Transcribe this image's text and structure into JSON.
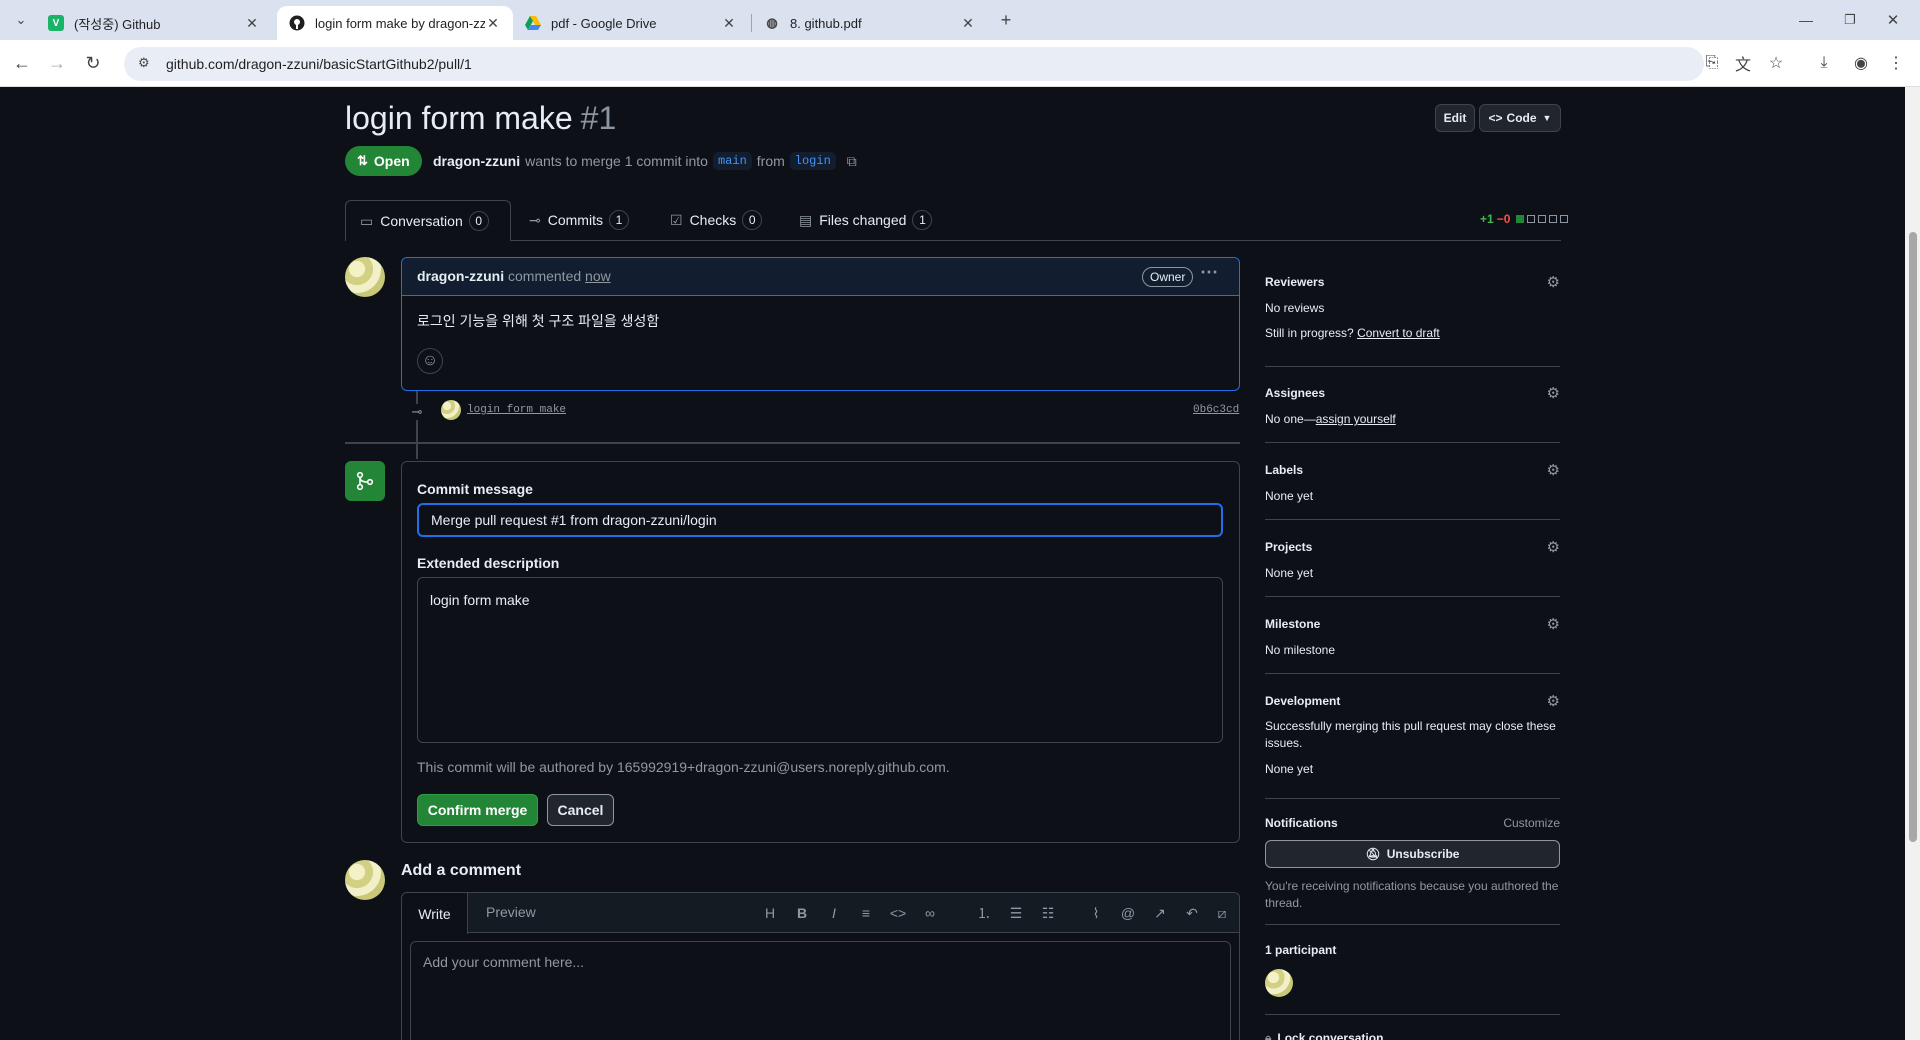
{
  "browser": {
    "tabs": [
      {
        "title": "(작성중) Github",
        "favicon": "V"
      },
      {
        "title": "login form make by dragon-zz",
        "favicon": "github-icon"
      },
      {
        "title": "pdf - Google Drive",
        "favicon": "drive-icon"
      },
      {
        "title": "8. github.pdf",
        "favicon": "globe-icon"
      }
    ],
    "url": "github.com/dragon-zzuni/basicStartGithub2/pull/1"
  },
  "pr": {
    "title": "login form make",
    "number": "#1",
    "status": "Open",
    "author": "dragon-zzuni",
    "merge_text": "wants to merge 1 commit into",
    "base_branch": "main",
    "from_text": "from",
    "head_branch": "login",
    "edit_label": "Edit",
    "code_label": "Code"
  },
  "tabs": [
    {
      "label": "Conversation",
      "count": "0"
    },
    {
      "label": "Commits",
      "count": "1"
    },
    {
      "label": "Checks",
      "count": "0"
    },
    {
      "label": "Files changed",
      "count": "1"
    }
  ],
  "diffstat": {
    "add": "+1",
    "del": "−0"
  },
  "comment": {
    "author": "dragon-zzuni",
    "action": "commented",
    "time": "now",
    "badge": "Owner",
    "body": "로그인 기능을 위해 첫 구조 파일을 생성함"
  },
  "commit": {
    "message": "login form make",
    "sha": "0b6c3cd"
  },
  "merge": {
    "commit_message_label": "Commit message",
    "commit_message_value": "Merge pull request #1 from dragon-zzuni/login",
    "extended_label": "Extended description",
    "extended_value": "login form make",
    "authored_note": "This commit will be authored by 165992919+dragon-zzuni@users.noreply.github.com.",
    "confirm_label": "Confirm merge",
    "cancel_label": "Cancel"
  },
  "add_comment": {
    "heading": "Add a comment",
    "write_tab": "Write",
    "preview_tab": "Preview",
    "placeholder": "Add your comment here..."
  },
  "sidebar": {
    "reviewers": {
      "label": "Reviewers",
      "value": "No reviews",
      "progress_text": "Still in progress?",
      "draft_link": "Convert to draft"
    },
    "assignees": {
      "label": "Assignees",
      "value": "No one—",
      "link": "assign yourself"
    },
    "labels": {
      "label": "Labels",
      "value": "None yet"
    },
    "projects": {
      "label": "Projects",
      "value": "None yet"
    },
    "milestone": {
      "label": "Milestone",
      "value": "No milestone"
    },
    "development": {
      "label": "Development",
      "desc": "Successfully merging this pull request may close these issues.",
      "value": "None yet"
    },
    "notifications": {
      "label": "Notifications",
      "customize": "Customize",
      "unsubscribe": "Unsubscribe",
      "note": "You're receiving notifications because you authored the thread."
    },
    "participants": {
      "label": "1 participant"
    },
    "lock": {
      "label": "Lock conversation"
    }
  },
  "colors": {
    "accent_green": "#238636",
    "link_blue": "#4493f8",
    "bg": "#0d1117"
  }
}
